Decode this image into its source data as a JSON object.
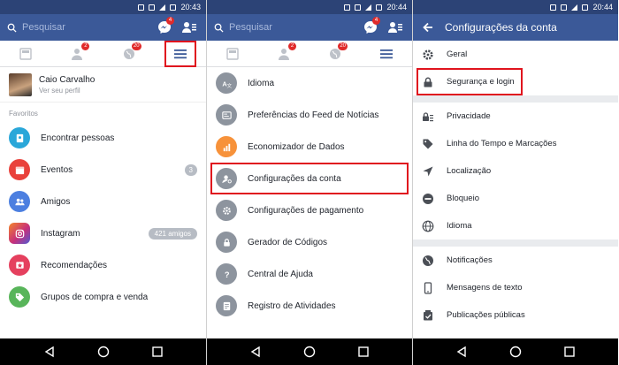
{
  "status": {
    "time_1": "20:43",
    "time_2": "20:44",
    "time_3": "20:44"
  },
  "topbar": {
    "search_placeholder": "Pesquisar",
    "messenger_badge": "4"
  },
  "tabs": {
    "friends_badge": "2",
    "notifications_badge": "20"
  },
  "panel1": {
    "profile_name": "Caio Carvalho",
    "profile_sub": "Ver seu perfil",
    "section_label": "Favoritos",
    "items": [
      {
        "label": "Encontrar pessoas",
        "icon": "find-people-icon",
        "color": "#2aa7d9"
      },
      {
        "label": "Eventos",
        "icon": "calendar-icon",
        "color": "#e9413b",
        "badge": "3"
      },
      {
        "label": "Amigos",
        "icon": "friends-icon",
        "color": "#4c7fe0"
      },
      {
        "label": "Instagram",
        "icon": "instagram-icon",
        "color": "#c7307a",
        "badge": "421 amigos"
      },
      {
        "label": "Recomendações",
        "icon": "star-icon",
        "color": "#e5405e"
      },
      {
        "label": "Grupos de compra e venda",
        "icon": "tag-icon",
        "color": "#58b55a"
      }
    ]
  },
  "panel2": {
    "items": [
      {
        "label": "Idioma",
        "icon": "language-icon"
      },
      {
        "label": "Preferências do Feed de Notícias",
        "icon": "feed-icon"
      },
      {
        "label": "Economizador de Dados",
        "icon": "data-saver-icon"
      },
      {
        "label": "Configurações da conta",
        "icon": "account-settings-icon"
      },
      {
        "label": "Configurações de pagamento",
        "icon": "gear-icon"
      },
      {
        "label": "Gerador de Códigos",
        "icon": "lock-icon"
      },
      {
        "label": "Central de Ajuda",
        "icon": "help-icon"
      },
      {
        "label": "Registro de Atividades",
        "icon": "activity-log-icon"
      }
    ]
  },
  "panel3": {
    "title": "Configurações da conta",
    "group1": [
      {
        "label": "Geral",
        "icon": "gear-icon"
      },
      {
        "label": "Segurança e login",
        "icon": "lock-icon"
      }
    ],
    "group2": [
      {
        "label": "Privacidade",
        "icon": "privacy-lock-icon"
      },
      {
        "label": "Linha do Tempo e Marcações",
        "icon": "tag-icon"
      },
      {
        "label": "Localização",
        "icon": "location-arrow-icon"
      },
      {
        "label": "Bloqueio",
        "icon": "block-icon"
      },
      {
        "label": "Idioma",
        "icon": "globe-icon"
      }
    ],
    "group3": [
      {
        "label": "Notificações",
        "icon": "globe-notification-icon"
      },
      {
        "label": "Mensagens de texto",
        "icon": "phone-icon"
      },
      {
        "label": "Publicações públicas",
        "icon": "public-posts-icon"
      }
    ]
  },
  "colors": {
    "brand": "#3b5998",
    "status_bar": "#2c4376",
    "highlight": "#e0141e",
    "gray_icon": "#606770"
  }
}
